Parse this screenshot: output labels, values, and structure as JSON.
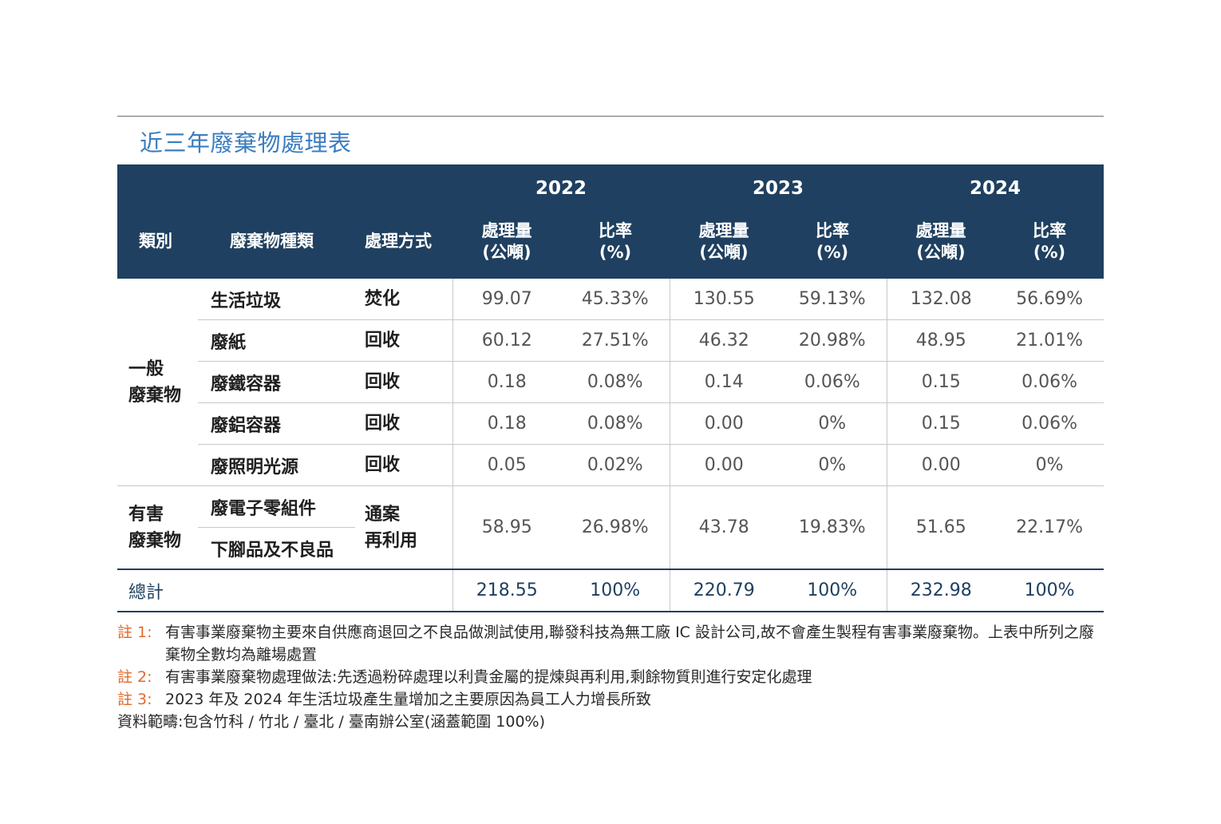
{
  "title": "近三年廢棄物處理表",
  "header": {
    "years": [
      "2022",
      "2023",
      "2024"
    ],
    "category": "類別",
    "waste_type": "廢棄物種類",
    "method": "處理方式",
    "amount_l1": "處理量",
    "amount_l2": "(公噸)",
    "ratio_l1": "比率",
    "ratio_l2": "(%)"
  },
  "general": {
    "category_l1": "一般",
    "category_l2": "廢棄物",
    "rows": [
      {
        "type": "生活垃圾",
        "method": "焚化",
        "v": [
          "99.07",
          "45.33%",
          "130.55",
          "59.13%",
          "132.08",
          "56.69%"
        ]
      },
      {
        "type": "廢紙",
        "method": "回收",
        "v": [
          "60.12",
          "27.51%",
          "46.32",
          "20.98%",
          "48.95",
          "21.01%"
        ]
      },
      {
        "type": "廢鐵容器",
        "method": "回收",
        "v": [
          "0.18",
          "0.08%",
          "0.14",
          "0.06%",
          "0.15",
          "0.06%"
        ]
      },
      {
        "type": "廢鋁容器",
        "method": "回收",
        "v": [
          "0.18",
          "0.08%",
          "0.00",
          "0%",
          "0.15",
          "0.06%"
        ]
      },
      {
        "type": "廢照明光源",
        "method": "回收",
        "v": [
          "0.05",
          "0.02%",
          "0.00",
          "0%",
          "0.00",
          "0%"
        ]
      }
    ]
  },
  "hazardous": {
    "category_l1": "有害",
    "category_l2": "廢棄物",
    "type1": "廢電子零組件",
    "type2": "下腳品及不良品",
    "method_l1": "通案",
    "method_l2": "再利用",
    "v": [
      "58.95",
      "26.98%",
      "43.78",
      "19.83%",
      "51.65",
      "22.17%"
    ]
  },
  "total": {
    "label": "總計",
    "v": [
      "218.55",
      "100%",
      "220.79",
      "100%",
      "232.98",
      "100%"
    ]
  },
  "notes": [
    {
      "prefix": "註 1:",
      "text": "有害事業廢棄物主要來自供應商退回之不良品做測試使用,聯發科技為無工廠 IC 設計公司,故不會產生製程有害事業廢棄物。上表中所列之廢棄物全數均為離場處置"
    },
    {
      "prefix": "註 2:",
      "text": "有害事業廢棄物處理做法:先透過粉碎處理以利貴金屬的提煉與再利用,剩餘物質則進行安定化處理"
    },
    {
      "prefix": "註 3:",
      "text": "2023 年及 2024 年生活垃圾產生量增加之主要原因為員工人力增長所致"
    }
  ],
  "scope": "資料範疇:包含竹科 / 竹北 / 臺北 / 臺南辦公室(涵蓋範圍 100%)",
  "colors": {
    "header_bg": "#1f4060",
    "title": "#3b7dc0",
    "note_prefix": "#e26a2c"
  }
}
